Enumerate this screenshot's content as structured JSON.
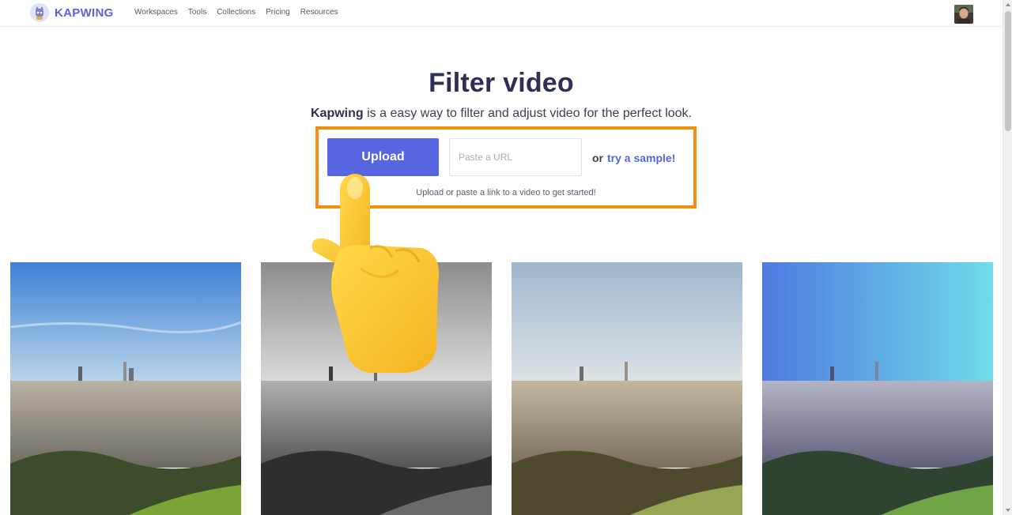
{
  "brand": {
    "name": "KAPWING",
    "color": "#5b63d8"
  },
  "nav": {
    "items": [
      {
        "label": "Workspaces"
      },
      {
        "label": "Tools"
      },
      {
        "label": "Collections"
      },
      {
        "label": "Pricing"
      },
      {
        "label": "Resources"
      }
    ]
  },
  "hero": {
    "title": "Filter video",
    "subtitle_brand": "Kapwing",
    "subtitle_rest": " is a easy way to filter and adjust video for the perfect look."
  },
  "upload": {
    "button_label": "Upload",
    "url_placeholder": "Paste a URL",
    "url_value": "",
    "or_label": "or",
    "sample_label": "try a sample!",
    "hint": "Upload or paste a link to a video to get started!",
    "highlight_color": "#f5900f",
    "button_color": "#5865e0"
  },
  "samples": [
    {
      "filter": "original"
    },
    {
      "filter": "grayscale"
    },
    {
      "filter": "faded"
    },
    {
      "filter": "cool"
    }
  ],
  "icons": {
    "logo": "kapwing-logo-icon",
    "avatar": "user-avatar",
    "pointer": "pointing-hand-icon"
  }
}
